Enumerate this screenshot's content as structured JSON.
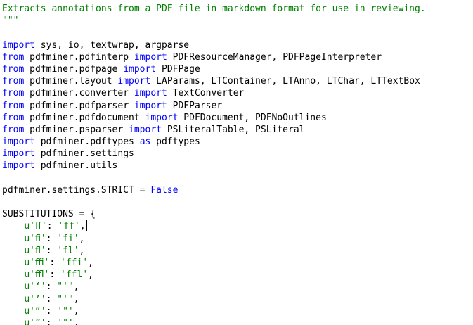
{
  "editor": {
    "colors": {
      "keyword": "#0000ff",
      "string": "#008000",
      "operator": "#666666",
      "text": "#000000",
      "background": "#ffffff"
    },
    "lines": [
      [
        {
          "t": "str",
          "v": "Extracts annotations from a PDF file in markdown format for use in reviewing."
        }
      ],
      [
        {
          "t": "str",
          "v": "\"\"\""
        }
      ],
      [],
      [
        {
          "t": "kw",
          "v": "import"
        },
        {
          "t": "txt",
          "v": " sys, io, textwrap, argparse"
        }
      ],
      [
        {
          "t": "kw",
          "v": "from"
        },
        {
          "t": "txt",
          "v": " pdfminer.pdfinterp "
        },
        {
          "t": "kw",
          "v": "import"
        },
        {
          "t": "txt",
          "v": " PDFResourceManager, PDFPageInterpreter"
        }
      ],
      [
        {
          "t": "kw",
          "v": "from"
        },
        {
          "t": "txt",
          "v": " pdfminer.pdfpage "
        },
        {
          "t": "kw",
          "v": "import"
        },
        {
          "t": "txt",
          "v": " PDFPage"
        }
      ],
      [
        {
          "t": "kw",
          "v": "from"
        },
        {
          "t": "txt",
          "v": " pdfminer.layout "
        },
        {
          "t": "kw",
          "v": "import"
        },
        {
          "t": "txt",
          "v": " LAParams, LTContainer, LTAnno, LTChar, LTTextBox"
        }
      ],
      [
        {
          "t": "kw",
          "v": "from"
        },
        {
          "t": "txt",
          "v": " pdfminer.converter "
        },
        {
          "t": "kw",
          "v": "import"
        },
        {
          "t": "txt",
          "v": " TextConverter"
        }
      ],
      [
        {
          "t": "kw",
          "v": "from"
        },
        {
          "t": "txt",
          "v": " pdfminer.pdfparser "
        },
        {
          "t": "kw",
          "v": "import"
        },
        {
          "t": "txt",
          "v": " PDFParser"
        }
      ],
      [
        {
          "t": "kw",
          "v": "from"
        },
        {
          "t": "txt",
          "v": " pdfminer.pdfdocument "
        },
        {
          "t": "kw",
          "v": "import"
        },
        {
          "t": "txt",
          "v": " PDFDocument, PDFNoOutlines"
        }
      ],
      [
        {
          "t": "kw",
          "v": "from"
        },
        {
          "t": "txt",
          "v": " pdfminer.psparser "
        },
        {
          "t": "kw",
          "v": "import"
        },
        {
          "t": "txt",
          "v": " PSLiteralTable, PSLiteral"
        }
      ],
      [
        {
          "t": "kw",
          "v": "import"
        },
        {
          "t": "txt",
          "v": " pdfminer.pdftypes "
        },
        {
          "t": "kw",
          "v": "as"
        },
        {
          "t": "txt",
          "v": " pdftypes"
        }
      ],
      [
        {
          "t": "kw",
          "v": "import"
        },
        {
          "t": "txt",
          "v": " pdfminer.settings"
        }
      ],
      [
        {
          "t": "kw",
          "v": "import"
        },
        {
          "t": "txt",
          "v": " pdfminer.utils"
        }
      ],
      [],
      [
        {
          "t": "txt",
          "v": "pdfminer.settings.STRICT "
        },
        {
          "t": "op",
          "v": "="
        },
        {
          "t": "txt",
          "v": " "
        },
        {
          "t": "kw",
          "v": "False"
        }
      ],
      [],
      [
        {
          "t": "txt",
          "v": "SUBSTITUTIONS "
        },
        {
          "t": "op",
          "v": "="
        },
        {
          "t": "txt",
          "v": " {"
        }
      ],
      [
        {
          "t": "ind",
          "v": "    "
        },
        {
          "t": "str",
          "v": "u'ﬀ'"
        },
        {
          "t": "txt",
          "v": ": "
        },
        {
          "t": "str",
          "v": "'ff'"
        },
        {
          "t": "txt",
          "v": ","
        },
        {
          "t": "caret",
          "v": ""
        }
      ],
      [
        {
          "t": "ind",
          "v": "    "
        },
        {
          "t": "str",
          "v": "u'ﬁ'"
        },
        {
          "t": "txt",
          "v": ": "
        },
        {
          "t": "str",
          "v": "'fi'"
        },
        {
          "t": "txt",
          "v": ","
        }
      ],
      [
        {
          "t": "ind",
          "v": "    "
        },
        {
          "t": "str",
          "v": "u'ﬂ'"
        },
        {
          "t": "txt",
          "v": ": "
        },
        {
          "t": "str",
          "v": "'fl'"
        },
        {
          "t": "txt",
          "v": ","
        }
      ],
      [
        {
          "t": "ind",
          "v": "    "
        },
        {
          "t": "str",
          "v": "u'ﬃ'"
        },
        {
          "t": "txt",
          "v": ": "
        },
        {
          "t": "str",
          "v": "'ffi'"
        },
        {
          "t": "txt",
          "v": ","
        }
      ],
      [
        {
          "t": "ind",
          "v": "    "
        },
        {
          "t": "str",
          "v": "u'ﬄ'"
        },
        {
          "t": "txt",
          "v": ": "
        },
        {
          "t": "str",
          "v": "'ffl'"
        },
        {
          "t": "txt",
          "v": ","
        }
      ],
      [
        {
          "t": "ind",
          "v": "    "
        },
        {
          "t": "str",
          "v": "u'‘'"
        },
        {
          "t": "txt",
          "v": ": "
        },
        {
          "t": "str",
          "v": "\"'\""
        },
        {
          "t": "txt",
          "v": ","
        }
      ],
      [
        {
          "t": "ind",
          "v": "    "
        },
        {
          "t": "str",
          "v": "u'’'"
        },
        {
          "t": "txt",
          "v": ": "
        },
        {
          "t": "str",
          "v": "\"'\""
        },
        {
          "t": "txt",
          "v": ","
        }
      ],
      [
        {
          "t": "ind",
          "v": "    "
        },
        {
          "t": "str",
          "v": "u'“'"
        },
        {
          "t": "txt",
          "v": ": "
        },
        {
          "t": "str",
          "v": "'\"'"
        },
        {
          "t": "txt",
          "v": ","
        }
      ],
      [
        {
          "t": "ind",
          "v": "    "
        },
        {
          "t": "str",
          "v": "u'”'"
        },
        {
          "t": "txt",
          "v": ": "
        },
        {
          "t": "str",
          "v": "'\"'"
        },
        {
          "t": "txt",
          "v": ","
        }
      ]
    ]
  }
}
